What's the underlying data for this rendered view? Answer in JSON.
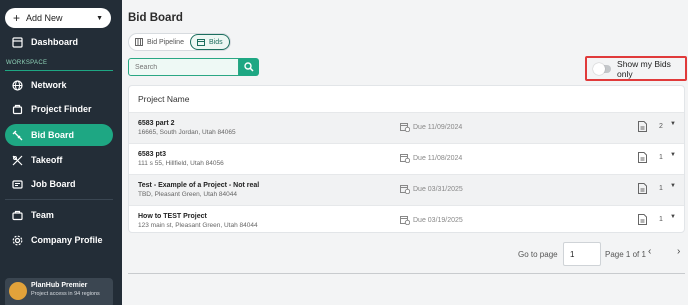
{
  "sidebar": {
    "add_new_label": "Add New",
    "dashboard_label": "Dashboard",
    "section_label": "WORKSPACE",
    "items": [
      {
        "label": "Network",
        "icon": "network-icon"
      },
      {
        "label": "Project Finder",
        "icon": "project-finder-icon"
      },
      {
        "label": "Bid Board",
        "icon": "bid-board-icon"
      },
      {
        "label": "Takeoff",
        "icon": "takeoff-icon"
      },
      {
        "label": "Job Board",
        "icon": "job-board-icon"
      },
      {
        "label": "Team",
        "icon": "team-icon"
      },
      {
        "label": "Company Profile",
        "icon": "company-profile-icon"
      }
    ],
    "active_item": "Bid Board",
    "premium": {
      "title": "PlanHub Premier",
      "subtitle": "Project access in 94 regions"
    }
  },
  "main": {
    "title": "Bid Board",
    "tabs": [
      {
        "label": "Bid Pipeline",
        "active": false
      },
      {
        "label": "Bids",
        "active": true
      }
    ],
    "search_placeholder": "Search",
    "toggle_label": "Show my Bids only",
    "toggle_on": false,
    "table": {
      "header": "Project Name",
      "rows": [
        {
          "name": "6583 part 2",
          "address": "16665, South Jordan, Utah 84065",
          "due": "Due 11/09/2024",
          "count": "2"
        },
        {
          "name": "6583 pt3",
          "address": "111 s 55, Hillfield, Utah 84056",
          "due": "Due 11/08/2024",
          "count": "1"
        },
        {
          "name": "Test - Example of a Project - Not real",
          "address": "TBD, Pleasant Green, Utah 84044",
          "due": "Due 03/31/2025",
          "count": "1"
        },
        {
          "name": "How to TEST Project",
          "address": "123 main st, Pleasant Green, Utah 84044",
          "due": "Due 03/19/2025",
          "count": "1"
        }
      ]
    },
    "pagination": {
      "goto_label": "Go to page",
      "current_page": "1",
      "page_of": "Page 1 of 1"
    }
  },
  "colors": {
    "sidebar_bg": "#232d37",
    "accent": "#1ea783",
    "highlight_box": "#e03a3a"
  }
}
